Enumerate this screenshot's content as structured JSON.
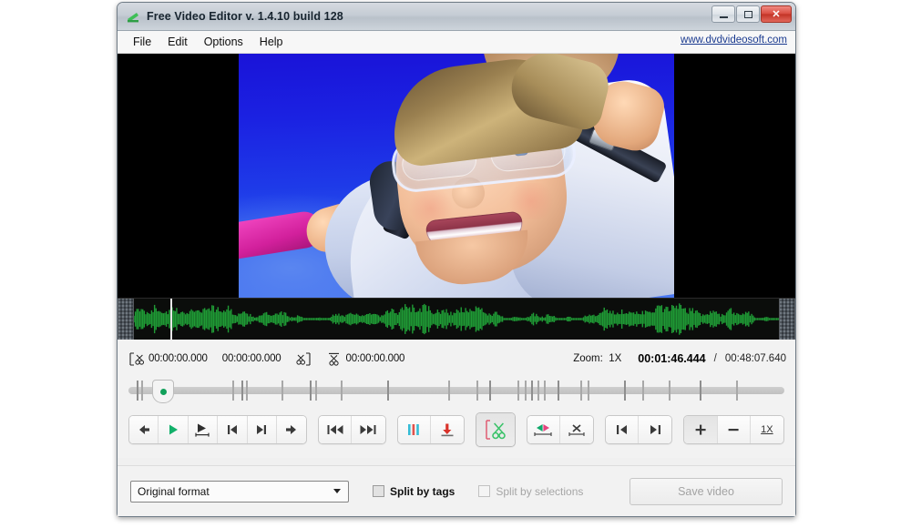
{
  "window": {
    "title": "Free Video Editor v. 1.4.10 build 128",
    "app_icon": "free-video-editor-icon",
    "controls": {
      "minimize": "–",
      "maximize": "□",
      "close": "✕"
    }
  },
  "menubar": {
    "items": [
      {
        "label": "File"
      },
      {
        "label": "Edit"
      },
      {
        "label": "Options"
      },
      {
        "label": "Help"
      }
    ],
    "weblink": "www.dvdvideosoft.com"
  },
  "video": {
    "description": "indoor-skydiving-woman-preview"
  },
  "waveform": {
    "description": "audio-waveform-green"
  },
  "timecodes": {
    "selection_start": "00:00:00.000",
    "selection_duration": "00:00:00.000",
    "selection_end": "00:00:00.000",
    "zoom_label": "Zoom:",
    "zoom_value": "1X",
    "current": "00:01:46.444",
    "separator": "/",
    "total": "00:48:07.640"
  },
  "transport": {
    "buttons": [
      {
        "name": "step-back-button",
        "glyph": "←"
      },
      {
        "name": "play-button",
        "glyph": "▶"
      },
      {
        "name": "play-selection-button",
        "glyph": "▶|"
      },
      {
        "name": "previous-marker-button",
        "glyph": "|◀"
      },
      {
        "name": "next-marker-button",
        "glyph": "▶|"
      },
      {
        "name": "step-forward-button",
        "glyph": "→"
      }
    ],
    "seek_buttons": [
      {
        "name": "rewind-button",
        "glyph": "◀◀"
      },
      {
        "name": "fast-forward-button",
        "glyph": "▶▶"
      }
    ],
    "tag_buttons": [
      {
        "name": "add-tag-button",
        "glyph": "|||"
      },
      {
        "name": "insert-marker-button",
        "glyph": "↓"
      }
    ],
    "cut_button": {
      "name": "cut-button",
      "glyph": "✂",
      "pressed": true
    },
    "selection_buttons": [
      {
        "name": "invert-selection-button",
        "glyph": "◀▶"
      },
      {
        "name": "delete-selection-button",
        "glyph": "✕"
      }
    ],
    "jump_buttons": [
      {
        "name": "jump-to-start-button",
        "glyph": "|←"
      },
      {
        "name": "jump-to-end-button",
        "glyph": "→|"
      }
    ],
    "zoom_buttons": [
      {
        "name": "zoom-in-button",
        "glyph": "+"
      },
      {
        "name": "zoom-out-button",
        "glyph": "−"
      },
      {
        "name": "zoom-reset-button",
        "glyph": "1X"
      }
    ]
  },
  "bottom": {
    "format_value": "Original format",
    "split_by_tags": "Split by tags",
    "split_by_selections": "Split by selections",
    "save_button": "Save video"
  },
  "colors": {
    "accent_green": "#11a05a",
    "waveform_green": "#1f9a35",
    "close_red": "#c23225",
    "link_blue": "#1a3a8f"
  }
}
